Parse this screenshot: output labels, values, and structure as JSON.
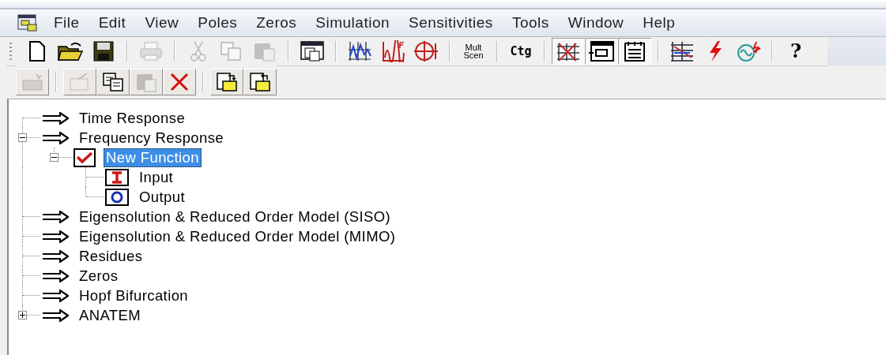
{
  "menu_bar": {
    "items": [
      "File",
      "Edit",
      "View",
      "Poles",
      "Zeros",
      "Simulation",
      "Sensitivities",
      "Tools",
      "Window",
      "Help"
    ]
  },
  "toolbars": [
    {
      "items": [
        {
          "kind": "button",
          "disabled": false,
          "pressed": false
        },
        {
          "kind": "button",
          "disabled": false,
          "pressed": false
        },
        {
          "kind": "button",
          "disabled": false,
          "pressed": false
        },
        {
          "kind": "separator"
        },
        {
          "kind": "button",
          "disabled": true,
          "pressed": false
        },
        {
          "kind": "separator"
        },
        {
          "kind": "button",
          "disabled": true,
          "pressed": false
        },
        {
          "kind": "button",
          "disabled": true,
          "pressed": false
        },
        {
          "kind": "button",
          "disabled": true,
          "pressed": false
        },
        {
          "kind": "separator"
        },
        {
          "kind": "button",
          "disabled": false,
          "pressed": false
        },
        {
          "kind": "separator"
        },
        {
          "kind": "button",
          "disabled": false,
          "pressed": false
        },
        {
          "kind": "button",
          "disabled": false,
          "pressed": false
        },
        {
          "kind": "button",
          "disabled": false,
          "pressed": false
        },
        {
          "kind": "separator"
        },
        {
          "kind": "text",
          "label": "Mult Scen",
          "disabled": false,
          "pressed": false
        },
        {
          "kind": "separator"
        },
        {
          "kind": "text",
          "label": "Ctg",
          "disabled": false,
          "pressed": false
        },
        {
          "kind": "separator"
        },
        {
          "kind": "button",
          "disabled": false,
          "pressed": true
        },
        {
          "kind": "button",
          "disabled": false,
          "pressed": true
        },
        {
          "kind": "button",
          "disabled": false,
          "pressed": true
        },
        {
          "kind": "separator"
        },
        {
          "kind": "button",
          "disabled": false,
          "pressed": false
        },
        {
          "kind": "button",
          "disabled": false,
          "pressed": false
        },
        {
          "kind": "button",
          "disabled": false,
          "pressed": false
        },
        {
          "kind": "separator"
        },
        {
          "kind": "text",
          "label": "?",
          "disabled": false,
          "pressed": false
        }
      ]
    },
    {
      "items": [
        {
          "kind": "button",
          "disabled": true,
          "pressed": false
        },
        {
          "kind": "separator"
        },
        {
          "kind": "button",
          "disabled": true,
          "pressed": false
        },
        {
          "kind": "button",
          "disabled": false,
          "pressed": false
        },
        {
          "kind": "button",
          "disabled": true,
          "pressed": false
        },
        {
          "kind": "button",
          "disabled": false,
          "pressed": false
        },
        {
          "kind": "separator"
        },
        {
          "kind": "button",
          "disabled": false,
          "pressed": false
        },
        {
          "kind": "button",
          "disabled": false,
          "pressed": false
        }
      ]
    }
  ],
  "tree": [
    {
      "label": "Time Response",
      "kind": "arrow",
      "selected": false
    },
    {
      "label": "Frequency Response",
      "kind": "arrow",
      "selected": false,
      "expanded": true,
      "children": [
        {
          "label": "New Function",
          "kind": "check",
          "selected": true,
          "expanded": true,
          "children": [
            {
              "label": "Input",
              "kind": "input",
              "selected": false
            },
            {
              "label": "Output",
              "kind": "output",
              "selected": false
            }
          ]
        }
      ]
    },
    {
      "label": "Eigensolution & Reduced Order Model (SISO)",
      "kind": "arrow",
      "selected": false
    },
    {
      "label": "Eigensolution & Reduced Order Model (MIMO)",
      "kind": "arrow",
      "selected": false
    },
    {
      "label": "Residues",
      "kind": "arrow",
      "selected": false
    },
    {
      "label": "Zeros",
      "kind": "arrow",
      "selected": false
    },
    {
      "label": "Hopf Bifurcation",
      "kind": "arrow",
      "selected": false
    },
    {
      "label": "ANATEM",
      "kind": "arrow",
      "selected": false,
      "expanded": false
    }
  ]
}
